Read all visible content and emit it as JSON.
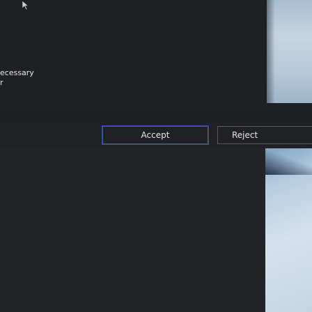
{
  "cookie_banner": {
    "side_text_1": "ecessary",
    "side_text_2": "r",
    "accept_label": "Accept",
    "reject_label": "Reject"
  },
  "icons": {
    "cursor": "cursor-icon"
  },
  "colors": {
    "background": "#1e1f22",
    "accept_focus_outline": "#2d4ea8",
    "button_border": "#5a5a5a",
    "text": "#e6e6e6"
  }
}
